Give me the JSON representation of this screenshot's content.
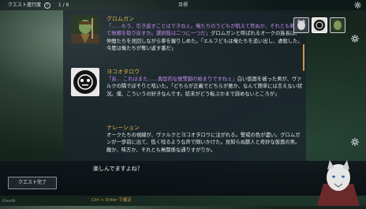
{
  "topbar": {
    "quest_label": "クエスト進行度",
    "count": "1 / 6",
    "center_label": "目標"
  },
  "entries": [
    {
      "speaker": "グロムガン",
      "highlight": "「……もう、引き返すことはできねぇ。俺たちのうどもが飢えて死ぬか、それとも戦って故郷を取り戻すか。選択肢は二つに一つだ」",
      "text": "グロムガンと呼ばれるオークの族長は、仲間たちを見回しながら拳を握りしめた。「エルフどもは俺たちを追い出し、虐殺した。今度は俺たちが奪い返す番だ」"
    },
    {
      "speaker": "ヨコオタロウ",
      "highlight": "「あ… これはまた……典型的な復讐劇の始まりですねぇ」",
      "text": "白い仮面を被った男が、ヴァルクの隣でぼそりと呟いた。「どちらが正義でどちらが悪か、なんて簡単には言えない状況。僕、こういうの好きなんです。結末がどう転ぶかまで読めないところが」"
    },
    {
      "speaker": "ナレーション",
      "text": "オークたちの視線が、ヴァルクとヨコオタロウに注がれる。警戒の色が濃い。グロムガンが一歩前に出て、低く唸るような声で問いかけた。見知らぬ獣人と奇妙な仮面の男。敵か、味方か、それとも無関係な通りすがりか。"
    }
  ],
  "input": {
    "reply": "楽しんでますよね？",
    "hint": "Ctrl + Enter で確定"
  },
  "buttons": {
    "complete": "クエスト完了"
  },
  "corner_label": "Cleurth",
  "colors": {
    "accent": "#c99a46",
    "speaker": "#e3b64a",
    "highlight": "#c48cf0"
  }
}
